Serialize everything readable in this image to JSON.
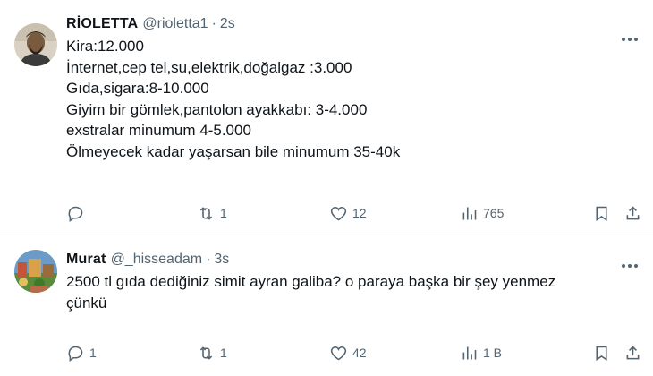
{
  "tweets": [
    {
      "name": "RİOLETTA",
      "handle": "@rioletta1",
      "separator": "·",
      "time": "2s",
      "lines": [
        "Kira:12.000",
        "İnternet,cep tel,su,elektrik,doğalgaz :3.000",
        "Gıda,sigara:8-10.000",
        "Giyim bir gömlek,pantolon ayakkabı: 3-4.000",
        "exstralar minumum 4-5.000",
        "Ölmeyecek kadar yaşarsan bile minumum 35-40k"
      ],
      "reply_count": "",
      "retweet_count": "1",
      "like_count": "12",
      "view_count": "765"
    },
    {
      "name": "Murat",
      "handle": "@_hisseadam",
      "separator": "·",
      "time": "3s",
      "lines": [
        "2500 tl gıda dediğiniz simit ayran galiba? o paraya başka bir şey yenmez",
        "çünkü"
      ],
      "reply_count": "1",
      "retweet_count": "1",
      "like_count": "42",
      "view_count": "1 B"
    }
  ],
  "icons": [
    "reply-icon",
    "retweet-icon",
    "like-icon",
    "views-icon",
    "bookmark-icon",
    "share-icon",
    "more-icon"
  ]
}
